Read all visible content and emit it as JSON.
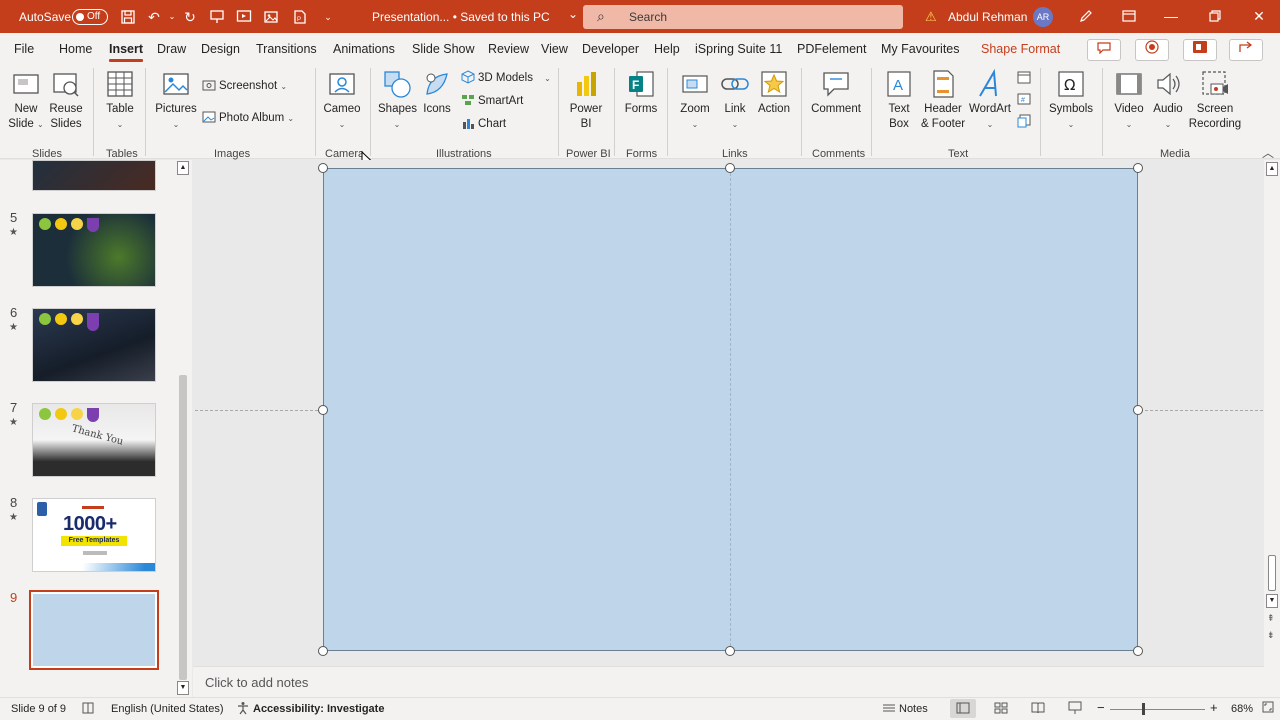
{
  "titlebar": {
    "autosave_label": "AutoSave",
    "autosave_state": "Off",
    "doc_title": "Presentation... • Saved to this PC",
    "doc_caret": "⌄",
    "search_placeholder": "Search",
    "user_name": "Abdul Rehman",
    "user_initials": "AR",
    "warning_icon": "⚠",
    "accent_color": "#c43e1c"
  },
  "tabs": [
    "File",
    "Home",
    "Insert",
    "Draw",
    "Design",
    "Transitions",
    "Animations",
    "Slide Show",
    "Review",
    "View",
    "Developer",
    "Help",
    "iSpring Suite 11",
    "PDFelement",
    "My Favourites",
    "Shape Format"
  ],
  "active_tab": "Insert",
  "ribbon": {
    "slides": {
      "new_slide": "New",
      "new_slide2": "Slide",
      "reuse": "Reuse",
      "reuse2": "Slides",
      "label": "Slides"
    },
    "tables": {
      "table": "Table",
      "label": "Tables"
    },
    "images": {
      "pictures": "Pictures",
      "screenshot": "Screenshot",
      "photo_album": "Photo Album",
      "label": "Images"
    },
    "camera": {
      "cameo": "Cameo",
      "label": "Camera"
    },
    "illustrations": {
      "shapes": "Shapes",
      "icons": "Icons",
      "models": "3D Models",
      "smartart": "SmartArt",
      "chart": "Chart",
      "label": "Illustrations"
    },
    "powerbi": {
      "power": "Power",
      "bi": "BI",
      "label": "Power BI"
    },
    "forms": {
      "forms": "Forms",
      "label": "Forms"
    },
    "links": {
      "zoom": "Zoom",
      "link": "Link",
      "action": "Action",
      "label": "Links"
    },
    "comments": {
      "comment": "Comment",
      "label": "Comments"
    },
    "text": {
      "textbox": "Text",
      "textbox2": "Box",
      "header": "Header",
      "header2": "& Footer",
      "wordart": "WordArt",
      "label": "Text"
    },
    "symbols": {
      "symbols": "Symbols"
    },
    "media": {
      "video": "Video",
      "audio": "Audio",
      "screen": "Screen",
      "recording": "Recording",
      "label": "Media"
    }
  },
  "slides_panel": {
    "slides": [
      {
        "num": "5",
        "star": "★"
      },
      {
        "num": "6",
        "star": "★"
      },
      {
        "num": "7",
        "star": "★"
      },
      {
        "num": "8",
        "star": "★"
      },
      {
        "num": "9",
        "star": ""
      }
    ],
    "slide7_text": "Thank You",
    "slide8_big": "1000+",
    "slide8_sub": "Free Templates"
  },
  "notes": {
    "placeholder": "Click to add notes"
  },
  "status": {
    "slide_info": "Slide 9 of 9",
    "language": "English (United States)",
    "accessibility": "Accessibility: Investigate",
    "notes": "Notes",
    "zoom": "68%"
  }
}
